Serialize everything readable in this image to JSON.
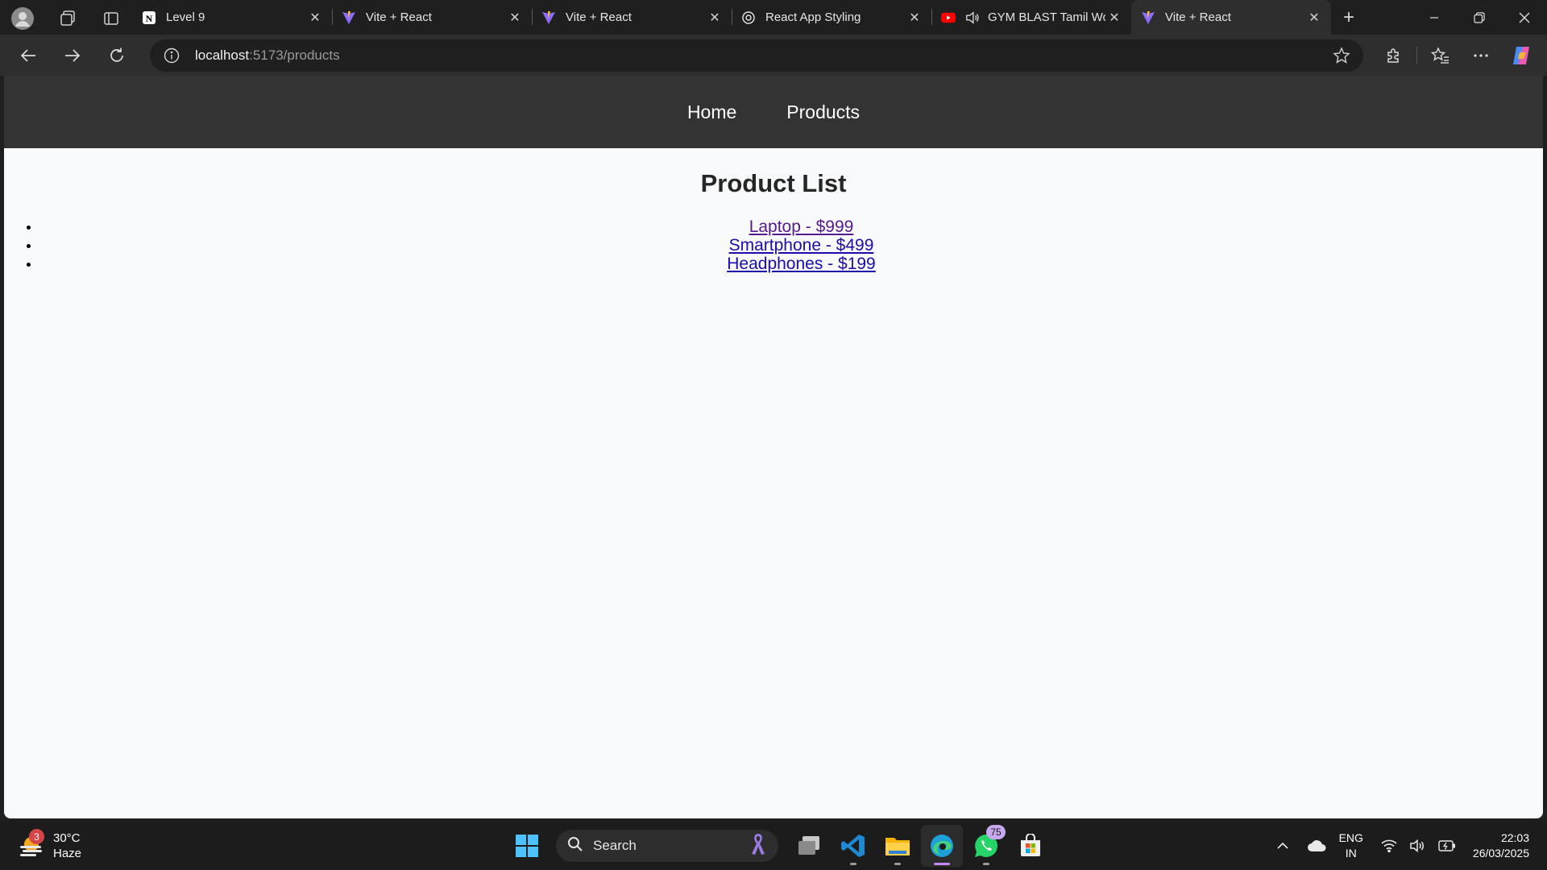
{
  "browser": {
    "tabs": [
      {
        "title": "Level 9",
        "favicon": "notion-icon",
        "active": false
      },
      {
        "title": "Vite + React",
        "favicon": "vite-icon",
        "active": false
      },
      {
        "title": "Vite + React",
        "favicon": "vite-icon",
        "active": false
      },
      {
        "title": "React App Styling",
        "favicon": "openai-icon",
        "active": false
      },
      {
        "title": "GYM BLAST Tamil Wo",
        "favicon": "youtube-icon",
        "audio": true,
        "active": false
      },
      {
        "title": "Vite + React",
        "favicon": "vite-icon",
        "active": true
      }
    ],
    "close_glyph": "✕",
    "new_tab_glyph": "+",
    "address": {
      "host": "localhost",
      "rest": ":5173/products"
    }
  },
  "site": {
    "nav": [
      {
        "label": "Home"
      },
      {
        "label": "Products"
      }
    ],
    "title": "Product List",
    "products": [
      {
        "label": "Laptop - $999",
        "visited": true
      },
      {
        "label": "Smartphone - $499",
        "visited": false
      },
      {
        "label": "Headphones - $199",
        "visited": false
      }
    ]
  },
  "taskbar": {
    "weather": {
      "temp": "30°C",
      "condition": "Haze",
      "badge": "3"
    },
    "search_placeholder": "Search",
    "whatsapp_badge": "75",
    "lang": {
      "line1": "ENG",
      "line2": "IN"
    },
    "clock": {
      "time": "22:03",
      "date": "26/03/2025"
    }
  },
  "colors": {
    "site_nav_bg": "#333333",
    "page_bg": "#f8f9fa",
    "link": "#1a0dab",
    "link_visited": "#551a8b",
    "browser_chrome": "#1f1f1f"
  }
}
